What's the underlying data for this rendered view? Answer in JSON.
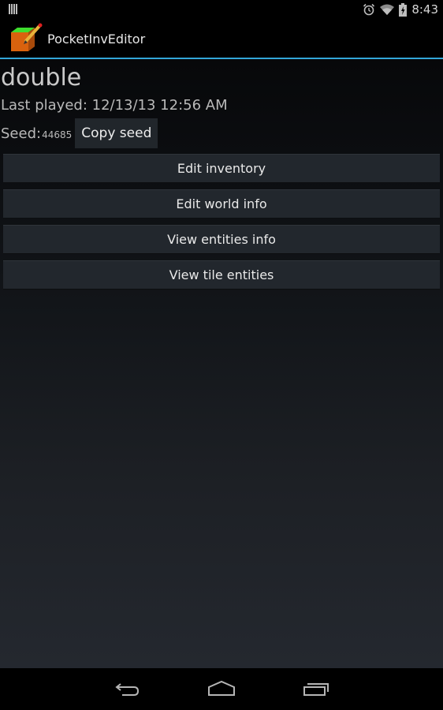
{
  "status_bar": {
    "left_icon": "notification-barcode-icon",
    "icons": [
      "alarm-icon",
      "wifi-icon",
      "battery-charging-icon"
    ],
    "time": "8:43"
  },
  "action_bar": {
    "app_icon": "pocketinveditor-icon",
    "title": "PocketInvEditor",
    "accent_color": "#33a6d9"
  },
  "world": {
    "name": "double",
    "last_played": "Last played: 12/13/13 12:56 AM",
    "seed_label": "Seed:",
    "seed_value": "44685",
    "copy_seed_label": "Copy seed"
  },
  "buttons": [
    {
      "label": "Edit inventory"
    },
    {
      "label": "Edit world info"
    },
    {
      "label": "View entities info"
    },
    {
      "label": "View tile entities"
    }
  ],
  "nav_bar": {
    "icons": [
      "back-icon",
      "home-icon",
      "recent-apps-icon"
    ]
  }
}
